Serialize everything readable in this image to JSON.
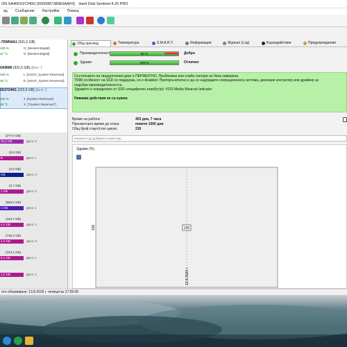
{
  "window": {
    "title_left": "ON SA400S37240G [50026B7380E6AAF0]",
    "title_right": "Hard Disk Sentinel 4.20 PRO"
  },
  "menu": [
    "ед",
    "Съобщения",
    "Настройки",
    "Помощ"
  ],
  "left_panel": {
    "disks": [
      {
        "name": "-75WN4A1",
        "size": "(931,5 GB)",
        "rows": [
          {
            "pct": "100 %",
            "drive": "G: [WesternDigital]"
          },
          {
            "pct": "37 °C",
            "drive": "D: [WesternDigital]"
          }
        ]
      },
      {
        "name": "0A9680",
        "size": "(931,5 GB)",
        "extra": "Диск: 1",
        "rows": [
          {
            "pct": "100 %",
            "drive": "L: [HGST_System Reserved]"
          },
          {
            "pct": "28 °C",
            "drive": "E: [HGST_System Reserved]"
          }
        ]
      },
      {
        "name": "0S37240G",
        "size": "(223,6 GB)",
        "extra": "Диск: 2",
        "rows": [
          {
            "pct": "100 %",
            "drive": "J: [System Reserved]"
          },
          {
            "pct": "28 °C",
            "drive": "X: [\"System Reserved\"]"
          }
        ]
      }
    ],
    "volumes": [
      {
        "size": "(277,5 GB)",
        "bar": "32,2 GB",
        "disk": "Диск: 0",
        "color": "#9c27b0"
      },
      {
        "size": "(0,6 GB)",
        "bar": "B",
        "disk": "Диск: 1",
        "color": "#b0188f"
      },
      {
        "size": "(0,5 GB)",
        "bar": "GB",
        "disk": "Диск: 2",
        "color": "#0b1f8c"
      },
      {
        "size": "(0,7 GB)",
        "bar": "1 GB",
        "disk": "Диск: 0",
        "color": "#b0188f"
      },
      {
        "size": "(653,2 GB)",
        "bar": "1 GB",
        "disk": "Диск: 1",
        "color": "#4a1fb2"
      },
      {
        "size": "(194,7 GB)",
        "bar": "4,1 GB",
        "disk": "Диск: 1",
        "color": "#b0188f"
      },
      {
        "size": "(736,2 GB)",
        "bar": "4,0 GB",
        "disk": "Диск: 0",
        "color": "#b0188f"
      },
      {
        "size": "(223,1 GB)",
        "bar": "8,1 GB",
        "disk": "Диск: 1",
        "color": "#b0188f"
      },
      {
        "size": "",
        "bar": "1,0 GB",
        "disk": "Диск: 2",
        "color": "#b0188f"
      }
    ]
  },
  "tabs": [
    "Общ преглед",
    "Температура",
    "S.M.A.R.T.",
    "Информация",
    "Журнал (Log)",
    "Бързодействие",
    "Предупреждения"
  ],
  "performance": {
    "label": "Производителност:",
    "value": "80 %",
    "fraction": 0.8,
    "status": "Добро"
  },
  "health": {
    "label": "Здраве:",
    "value": "100 %",
    "fraction": 1.0,
    "status": "Отлично"
  },
  "message": {
    "lines": [
      "Състоянието на твърдотелния диск е ПЕРФЕКТНО. Проблемни или слаби сектори не бяха намерени.",
      "TRIM особеност на SSD се поддържа, но е disabled. Препоръчително е да се надградите операционната система, дисковия контролер или драйвер за",
      "подобри производителността.",
      "Здравето е определено от SSD специфичен атрибут(и): #233 Media Wearout Indicator"
    ],
    "action": "Никакви действия не са нужни."
  },
  "info": [
    {
      "label": "Време на работа:",
      "value": "403 дни, 7 часа"
    },
    {
      "label": "Пресметнато време до отказ:",
      "value": "повече 1000 дни"
    },
    {
      "label": "Общ брой старт/стоп цикли:",
      "value": "230"
    }
  ],
  "comment_placeholder": "Кликнете да добавите коментар...",
  "health_chart_title": "Здраве (%)",
  "chart_data": {
    "type": "line",
    "title": "Здраве (%)",
    "x": [
      "13.8.2026 г."
    ],
    "series": [
      {
        "values": [
          100
        ]
      }
    ],
    "ylabel": "",
    "y_tick_labels": [
      "100"
    ],
    "grid": false
  },
  "status_bar": "ото обновяване: 13.8.2026 г. четвъртък 17:59:00"
}
